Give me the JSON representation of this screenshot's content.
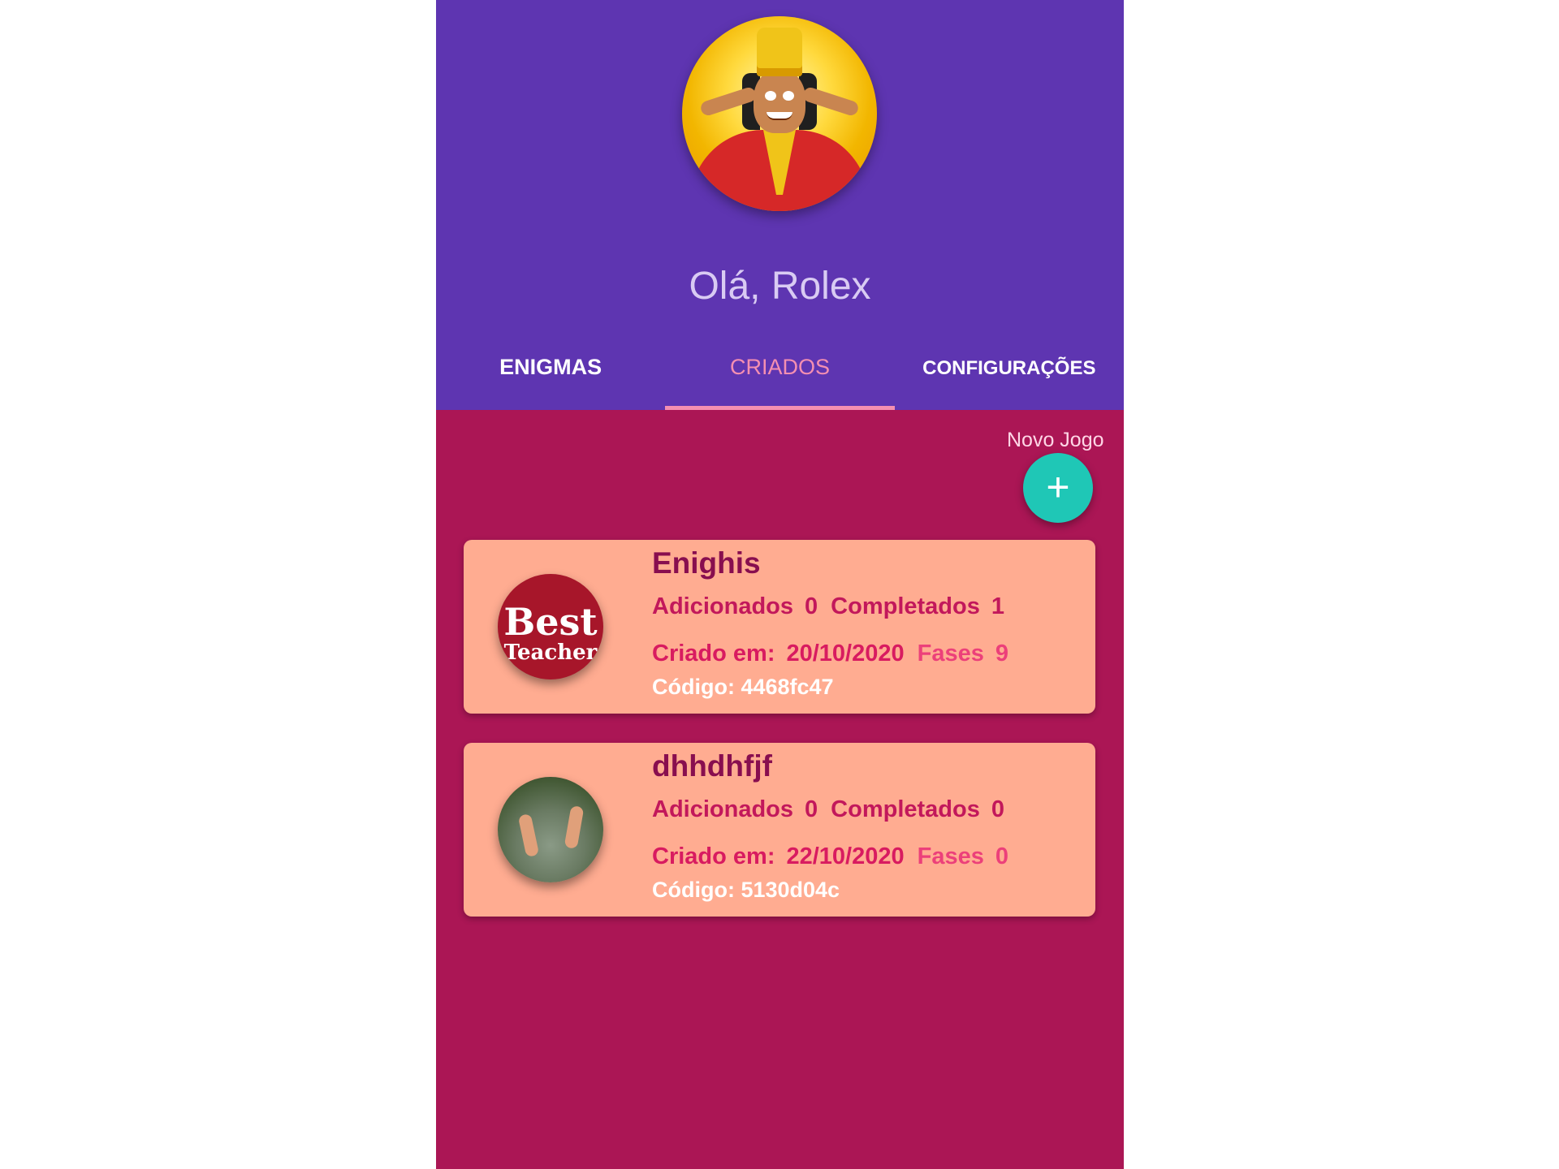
{
  "header": {
    "greeting": "Olá, Rolex"
  },
  "tabs": [
    {
      "label": "ENIGMAS",
      "active": false
    },
    {
      "label": "CRIADOS",
      "active": true
    },
    {
      "label": "CONFIGURAÇÕES",
      "active": false
    }
  ],
  "fab": {
    "label": "Novo Jogo",
    "icon": "plus-icon",
    "symbol": "+"
  },
  "games": [
    {
      "title": "Enighis",
      "added_label": "Adicionados",
      "added": "0",
      "completed_label": "Completados",
      "completed": "1",
      "created_label": "Criado em:",
      "created_date": "20/10/2020",
      "phases_label": "Fases",
      "phases": "9",
      "code": "Código: 4468fc47",
      "thumb_text": [
        "Best",
        "Teacher"
      ]
    },
    {
      "title": "dhhdhfjf",
      "added_label": "Adicionados",
      "added": "0",
      "completed_label": "Completados",
      "completed": "0",
      "created_label": "Criado em:",
      "created_date": "22/10/2020",
      "phases_label": "Fases",
      "phases": "0",
      "code": "Código: 5130d04c"
    }
  ],
  "colors": {
    "header_bg": "#5e35b1",
    "body_bg": "#ab1655",
    "card_bg": "#ffac91",
    "fab_bg": "#1fc7b6",
    "active_tab": "#f48fb1"
  }
}
